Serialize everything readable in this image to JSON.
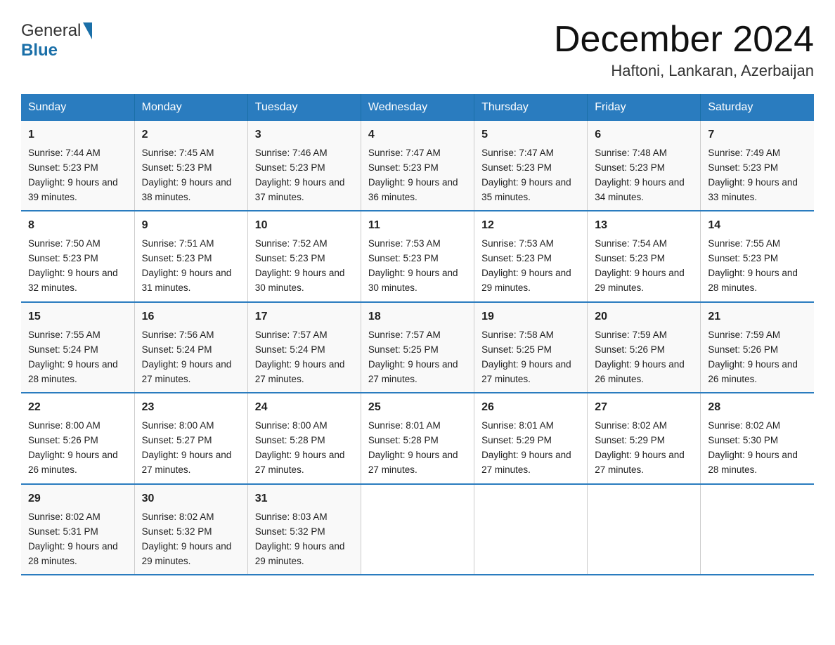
{
  "logo": {
    "general": "General",
    "blue": "Blue",
    "arrow": "▶"
  },
  "title": "December 2024",
  "subtitle": "Haftoni, Lankaran, Azerbaijan",
  "days": [
    "Sunday",
    "Monday",
    "Tuesday",
    "Wednesday",
    "Thursday",
    "Friday",
    "Saturday"
  ],
  "weeks": [
    [
      {
        "day": 1,
        "sunrise": "7:44 AM",
        "sunset": "5:23 PM",
        "daylight": "9 hours and 39 minutes."
      },
      {
        "day": 2,
        "sunrise": "7:45 AM",
        "sunset": "5:23 PM",
        "daylight": "9 hours and 38 minutes."
      },
      {
        "day": 3,
        "sunrise": "7:46 AM",
        "sunset": "5:23 PM",
        "daylight": "9 hours and 37 minutes."
      },
      {
        "day": 4,
        "sunrise": "7:47 AM",
        "sunset": "5:23 PM",
        "daylight": "9 hours and 36 minutes."
      },
      {
        "day": 5,
        "sunrise": "7:47 AM",
        "sunset": "5:23 PM",
        "daylight": "9 hours and 35 minutes."
      },
      {
        "day": 6,
        "sunrise": "7:48 AM",
        "sunset": "5:23 PM",
        "daylight": "9 hours and 34 minutes."
      },
      {
        "day": 7,
        "sunrise": "7:49 AM",
        "sunset": "5:23 PM",
        "daylight": "9 hours and 33 minutes."
      }
    ],
    [
      {
        "day": 8,
        "sunrise": "7:50 AM",
        "sunset": "5:23 PM",
        "daylight": "9 hours and 32 minutes."
      },
      {
        "day": 9,
        "sunrise": "7:51 AM",
        "sunset": "5:23 PM",
        "daylight": "9 hours and 31 minutes."
      },
      {
        "day": 10,
        "sunrise": "7:52 AM",
        "sunset": "5:23 PM",
        "daylight": "9 hours and 30 minutes."
      },
      {
        "day": 11,
        "sunrise": "7:53 AM",
        "sunset": "5:23 PM",
        "daylight": "9 hours and 30 minutes."
      },
      {
        "day": 12,
        "sunrise": "7:53 AM",
        "sunset": "5:23 PM",
        "daylight": "9 hours and 29 minutes."
      },
      {
        "day": 13,
        "sunrise": "7:54 AM",
        "sunset": "5:23 PM",
        "daylight": "9 hours and 29 minutes."
      },
      {
        "day": 14,
        "sunrise": "7:55 AM",
        "sunset": "5:23 PM",
        "daylight": "9 hours and 28 minutes."
      }
    ],
    [
      {
        "day": 15,
        "sunrise": "7:55 AM",
        "sunset": "5:24 PM",
        "daylight": "9 hours and 28 minutes."
      },
      {
        "day": 16,
        "sunrise": "7:56 AM",
        "sunset": "5:24 PM",
        "daylight": "9 hours and 27 minutes."
      },
      {
        "day": 17,
        "sunrise": "7:57 AM",
        "sunset": "5:24 PM",
        "daylight": "9 hours and 27 minutes."
      },
      {
        "day": 18,
        "sunrise": "7:57 AM",
        "sunset": "5:25 PM",
        "daylight": "9 hours and 27 minutes."
      },
      {
        "day": 19,
        "sunrise": "7:58 AM",
        "sunset": "5:25 PM",
        "daylight": "9 hours and 27 minutes."
      },
      {
        "day": 20,
        "sunrise": "7:59 AM",
        "sunset": "5:26 PM",
        "daylight": "9 hours and 26 minutes."
      },
      {
        "day": 21,
        "sunrise": "7:59 AM",
        "sunset": "5:26 PM",
        "daylight": "9 hours and 26 minutes."
      }
    ],
    [
      {
        "day": 22,
        "sunrise": "8:00 AM",
        "sunset": "5:26 PM",
        "daylight": "9 hours and 26 minutes."
      },
      {
        "day": 23,
        "sunrise": "8:00 AM",
        "sunset": "5:27 PM",
        "daylight": "9 hours and 27 minutes."
      },
      {
        "day": 24,
        "sunrise": "8:00 AM",
        "sunset": "5:28 PM",
        "daylight": "9 hours and 27 minutes."
      },
      {
        "day": 25,
        "sunrise": "8:01 AM",
        "sunset": "5:28 PM",
        "daylight": "9 hours and 27 minutes."
      },
      {
        "day": 26,
        "sunrise": "8:01 AM",
        "sunset": "5:29 PM",
        "daylight": "9 hours and 27 minutes."
      },
      {
        "day": 27,
        "sunrise": "8:02 AM",
        "sunset": "5:29 PM",
        "daylight": "9 hours and 27 minutes."
      },
      {
        "day": 28,
        "sunrise": "8:02 AM",
        "sunset": "5:30 PM",
        "daylight": "9 hours and 28 minutes."
      }
    ],
    [
      {
        "day": 29,
        "sunrise": "8:02 AM",
        "sunset": "5:31 PM",
        "daylight": "9 hours and 28 minutes."
      },
      {
        "day": 30,
        "sunrise": "8:02 AM",
        "sunset": "5:32 PM",
        "daylight": "9 hours and 29 minutes."
      },
      {
        "day": 31,
        "sunrise": "8:03 AM",
        "sunset": "5:32 PM",
        "daylight": "9 hours and 29 minutes."
      },
      null,
      null,
      null,
      null
    ]
  ]
}
